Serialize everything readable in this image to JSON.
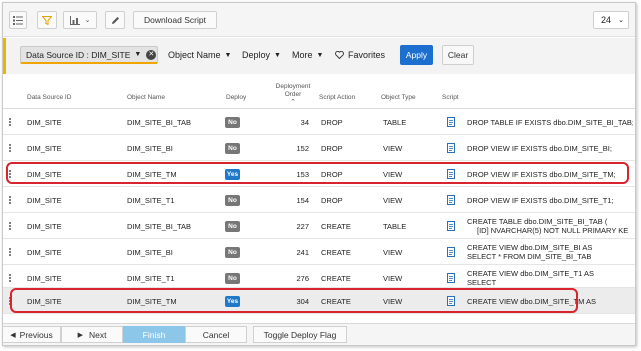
{
  "toolbar": {
    "list_icon": "list-icon",
    "filter_icon": "filter-icon",
    "chart_icon": "chart-icon",
    "edit_icon": "pencil-icon",
    "download_label": "Download Script",
    "page_size": "24"
  },
  "filters": {
    "chip_label": "Data Source ID : DIM_SITE",
    "object_name": "Object Name",
    "deploy": "Deploy",
    "more": "More",
    "favorites": "Favorites",
    "apply": "Apply",
    "clear": "Clear"
  },
  "table": {
    "headers": {
      "data_source_id": "Data Source ID",
      "object_name": "Object Name",
      "deploy": "Deploy",
      "deployment_order_1": "Deployment",
      "deployment_order_2": "Order",
      "script_action": "Script Action",
      "object_type": "Object Type",
      "script": "Script"
    },
    "rows": [
      {
        "ds": "DIM_SITE",
        "name": "DIM_SITE_BI_TAB",
        "deploy": "No",
        "order": "34",
        "action": "DROP",
        "type": "TABLE",
        "script1": "DROP TABLE IF EXISTS dbo.DIM_SITE_BI_TAB;",
        "script2": ""
      },
      {
        "ds": "DIM_SITE",
        "name": "DIM_SITE_BI",
        "deploy": "No",
        "order": "152",
        "action": "DROP",
        "type": "VIEW",
        "script1": "DROP VIEW IF EXISTS dbo.DIM_SITE_BI;",
        "script2": ""
      },
      {
        "ds": "DIM_SITE",
        "name": "DIM_SITE_TM",
        "deploy": "Yes",
        "order": "153",
        "action": "DROP",
        "type": "VIEW",
        "script1": "DROP VIEW IF EXISTS dbo.DIM_SITE_TM;",
        "script2": ""
      },
      {
        "ds": "DIM_SITE",
        "name": "DIM_SITE_T1",
        "deploy": "No",
        "order": "154",
        "action": "DROP",
        "type": "VIEW",
        "script1": "DROP VIEW IF EXISTS dbo.DIM_SITE_T1;",
        "script2": ""
      },
      {
        "ds": "DIM_SITE",
        "name": "DIM_SITE_BI_TAB",
        "deploy": "No",
        "order": "227",
        "action": "CREATE",
        "type": "TABLE",
        "script1": "CREATE TABLE dbo.DIM_SITE_BI_TAB (",
        "script2": "[ID] NVARCHAR(5) NOT NULL PRIMARY KE"
      },
      {
        "ds": "DIM_SITE",
        "name": "DIM_SITE_BI",
        "deploy": "No",
        "order": "241",
        "action": "CREATE",
        "type": "VIEW",
        "script1": "CREATE VIEW dbo.DIM_SITE_BI AS",
        "script2": "SELECT * FROM DIM_SITE_BI_TAB"
      },
      {
        "ds": "DIM_SITE",
        "name": "DIM_SITE_T1",
        "deploy": "No",
        "order": "276",
        "action": "CREATE",
        "type": "VIEW",
        "script1": "CREATE VIEW dbo.DIM_SITE_T1 AS",
        "script2": "SELECT"
      },
      {
        "ds": "DIM_SITE",
        "name": "DIM_SITE_TM",
        "deploy": "Yes",
        "order": "304",
        "action": "CREATE",
        "type": "VIEW",
        "script1": "CREATE VIEW dbo.DIM_SITE_TM AS",
        "script2": ""
      }
    ]
  },
  "footer": {
    "previous": "Previous",
    "next": "Next",
    "finish": "Finish",
    "cancel": "Cancel",
    "toggle": "Toggle Deploy Flag"
  },
  "colors": {
    "accent": "#1d6fcf",
    "yes_badge": "#1f78c8",
    "no_badge": "#777777",
    "highlight": "#d9232e",
    "filter_accent": "#e8b800"
  }
}
